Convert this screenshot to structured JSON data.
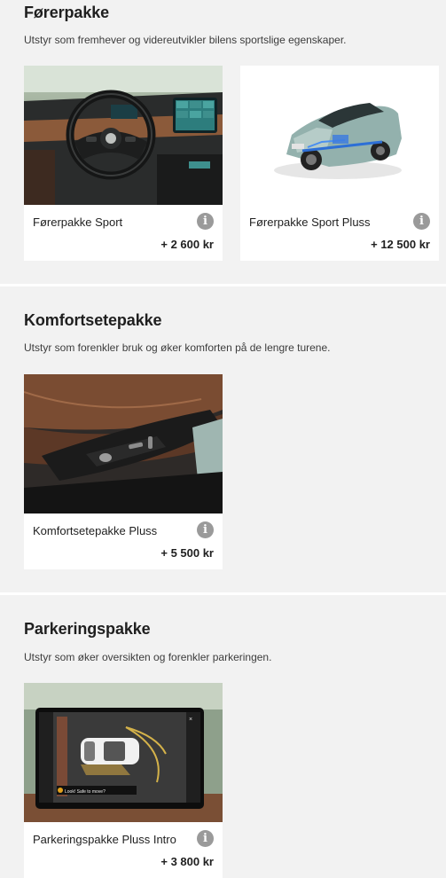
{
  "packages": [
    {
      "title": "Førerpakke",
      "description": "Utstyr som fremhever og videreutvikler bilens sportslige egenskaper.",
      "items": [
        {
          "name": "Førerpakke Sport",
          "price": "+ 2 600 kr",
          "icon": "info-icon"
        },
        {
          "name": "Førerpakke Sport Pluss",
          "price": "+ 12 500 kr",
          "icon": "info-icon"
        }
      ]
    },
    {
      "title": "Komfortsetepakke",
      "description": "Utstyr som forenkler bruk og øker komforten på de lengre turene.",
      "items": [
        {
          "name": "Komfortsetepakke Pluss",
          "price": "+ 5 500 kr",
          "icon": "info-icon"
        }
      ]
    },
    {
      "title": "Parkeringspakke",
      "description": "Utstyr som øker oversikten og forenkler parkeringen.",
      "items": [
        {
          "name": "Parkeringspakke Pluss Intro",
          "price": "+ 3 800 kr",
          "icon": "info-icon",
          "screen_alert": "Look! Safe to move?"
        }
      ]
    }
  ],
  "colors": {
    "background": "#f2f2f2",
    "card": "#ffffff",
    "info_icon": "#9a9a9a",
    "text": "#1f1f1f"
  }
}
